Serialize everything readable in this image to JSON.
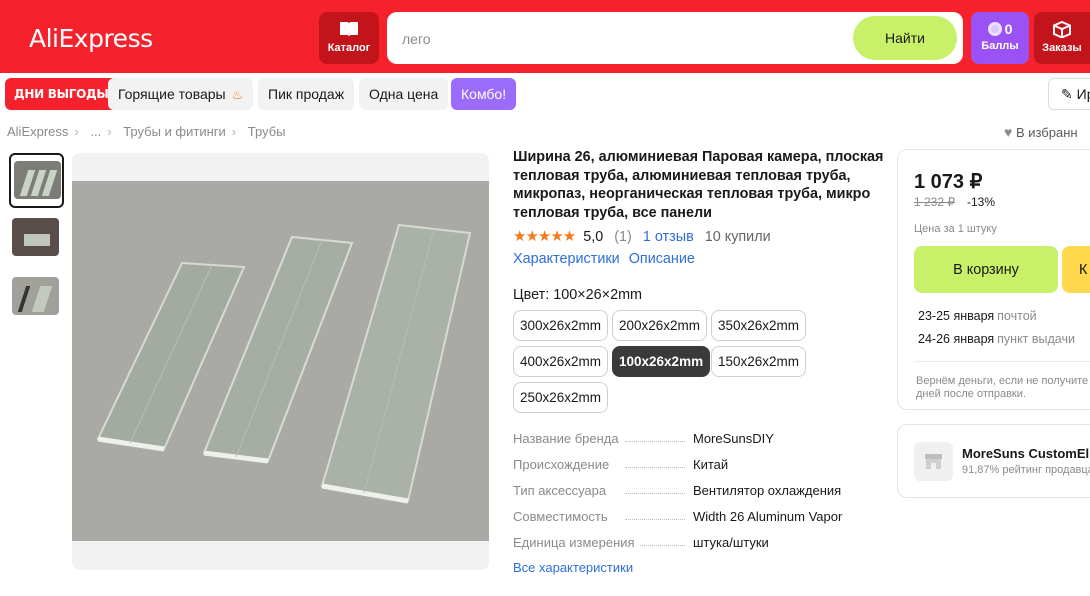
{
  "header": {
    "logo": "AliExpress",
    "catalog_label": "Каталог",
    "search_placeholder": "лего",
    "search_button": "Найти",
    "points_value": "0",
    "points_label": "Баллы",
    "orders_label": "Заказы"
  },
  "nav": {
    "promo": "ДНИ ВЫГОДЫ",
    "chips": [
      "Горящие товары",
      "Пик продаж",
      "Одна цена",
      "Комбо!"
    ],
    "user_label": "Ир"
  },
  "breadcrumbs": [
    "AliExpress",
    "...",
    "Трубы и фитинги",
    "Трубы"
  ],
  "favorites_label": "В избранн",
  "product": {
    "title": "Ширина 26, алюминиевая Паровая камера, плоская тепловая труба, алюминиевая тепловая труба, микропаз, неорганическая тепловая труба, микро тепловая труба, все панели",
    "stars": "★★★★★",
    "rating": "5,0",
    "rating_count": "(1)",
    "reviews": "1 отзыв",
    "sold": "10 купили",
    "tabs": [
      "Характеристики",
      "Описание"
    ],
    "color_label": "Цвет: 100×26×2mm",
    "options": [
      "300x26x2mm",
      "200x26x2mm",
      "350x26x2mm",
      "400x26x2mm",
      "100x26x2mm",
      "150x26x2mm",
      "250x26x2mm"
    ],
    "selected_option": "100x26x2mm",
    "specs": [
      {
        "k": "Название бренда",
        "v": "MoreSunsDIY"
      },
      {
        "k": "Происхождение",
        "v": "Китай"
      },
      {
        "k": "Тип аксессуара",
        "v": "Вентилятор охлаждения"
      },
      {
        "k": "Совместимость",
        "v": "Width 26 Aluminum Vapor"
      },
      {
        "k": "Единица измерения",
        "v": "штука/штуки"
      }
    ],
    "all_specs": "Все характеристики"
  },
  "buy": {
    "price": "1 073 ₽",
    "old_price": "1 232 ₽",
    "discount": "-13%",
    "per_unit": "Цена за 1 штуку",
    "cart_button": "В корзину",
    "buy_button": "К",
    "delivery": [
      {
        "date": "23-25 января",
        "method": "почтой"
      },
      {
        "date": "24-26 января",
        "method": "пункт выдачи"
      }
    ],
    "refund_line1": "Вернём деньги, если не получите",
    "refund_line2": "дней после отправки."
  },
  "store": {
    "name": "MoreSuns CustomEl",
    "rating": "91,87% рейтинг продавца"
  },
  "colors": {
    "brand_red": "#f5222d",
    "accent_green": "#c8f068",
    "link_blue": "#2f6edb",
    "purple": "#9b52f5",
    "star_orange": "#f57a1b"
  }
}
